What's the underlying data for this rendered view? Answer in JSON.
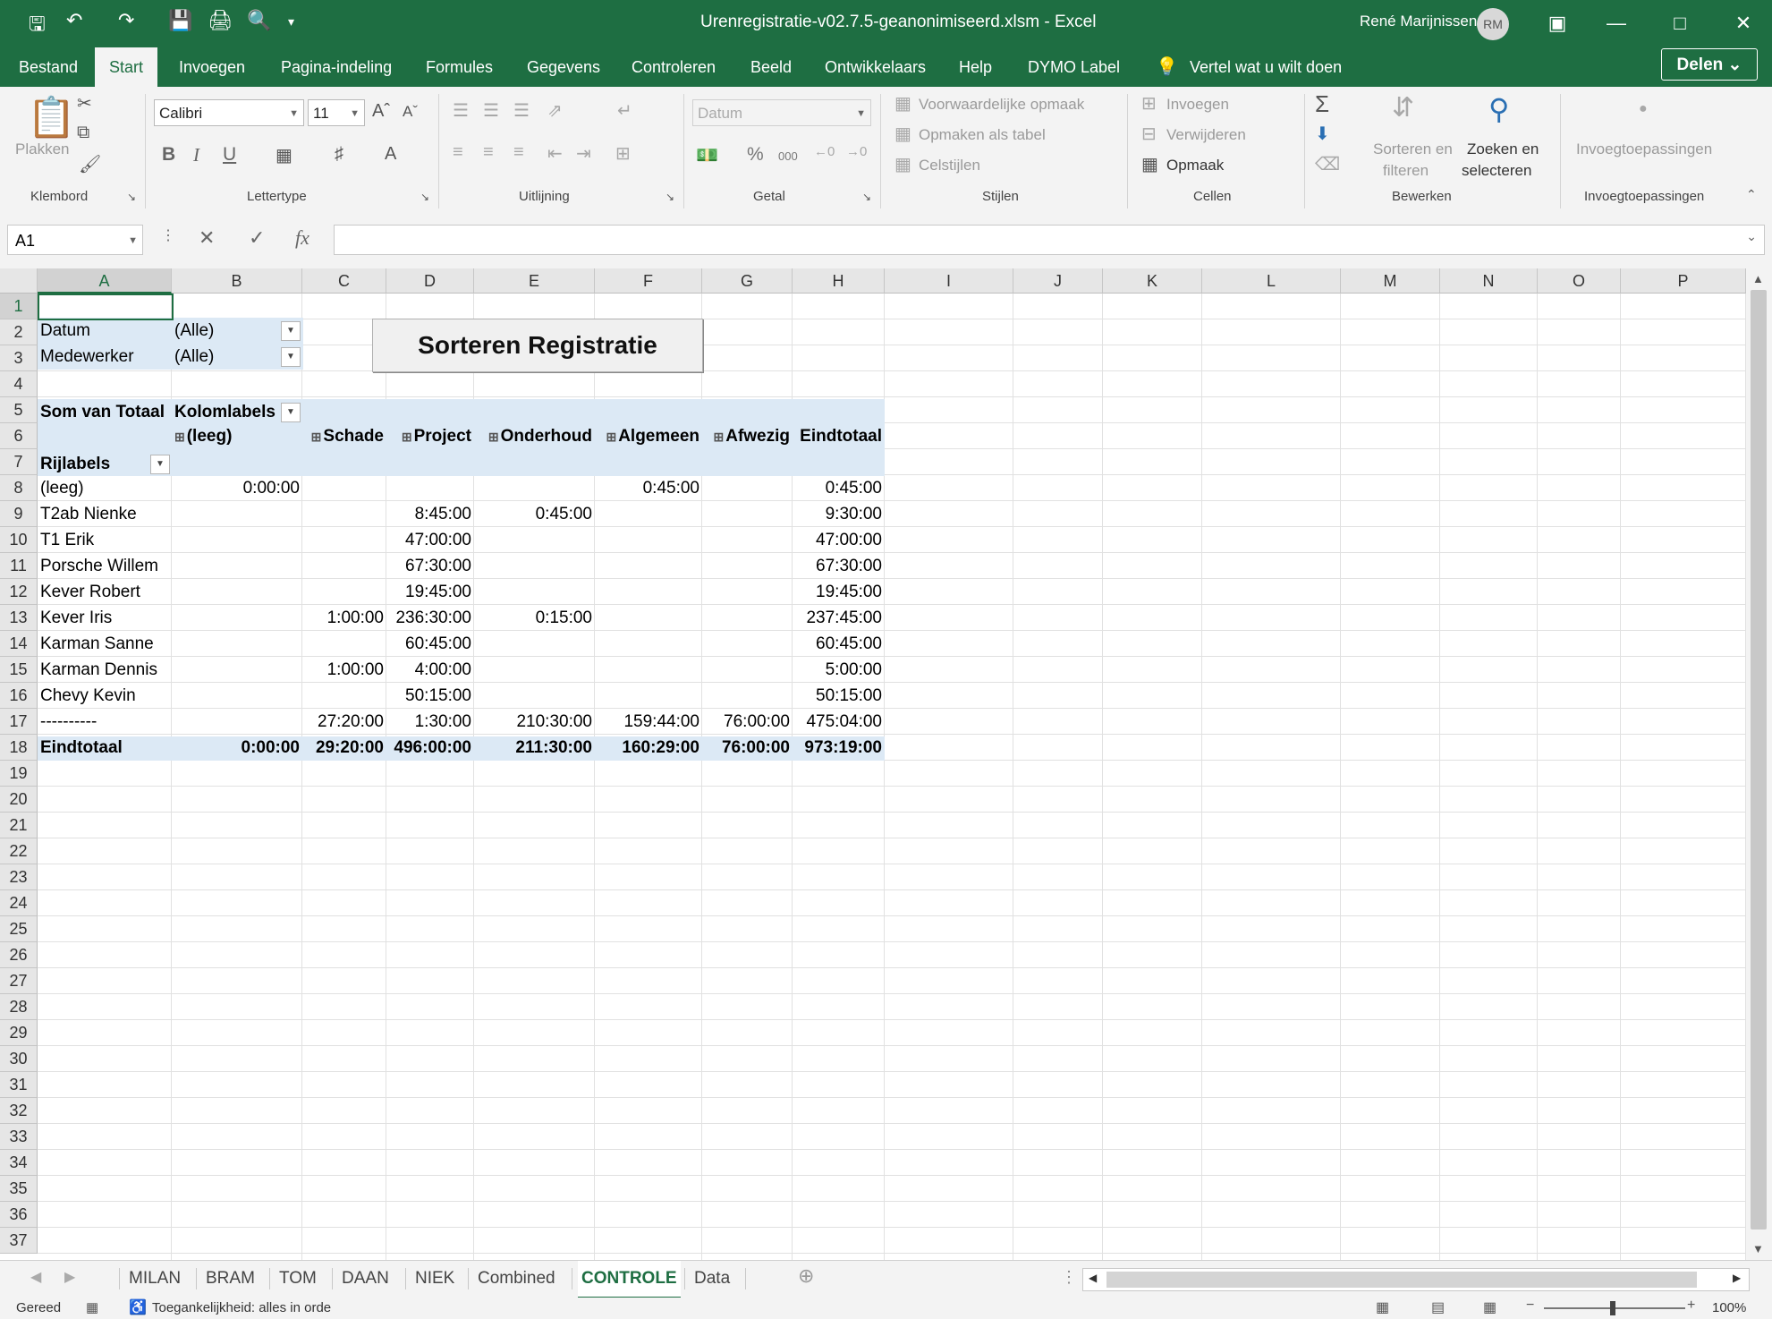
{
  "window": {
    "title": "Urenregistratie-v02.7.5-geanonimiseerd.xlsm  -  Excel",
    "user_name": "René Marijnissen",
    "user_initials": "RM"
  },
  "menu": {
    "tabs": [
      "Bestand",
      "Start",
      "Invoegen",
      "Pagina-indeling",
      "Formules",
      "Gegevens",
      "Controleren",
      "Beeld",
      "Ontwikkelaars",
      "Help",
      "DYMO Label"
    ],
    "tell_me": "Vertel wat u wilt doen",
    "share": "Delen"
  },
  "ribbon": {
    "clipboard": {
      "paste": "Plakken",
      "label": "Klembord"
    },
    "font": {
      "name": "Calibri",
      "size": "11",
      "label": "Lettertype",
      "bold": "B",
      "italic": "I",
      "underline": "U"
    },
    "alignment": {
      "label": "Uitlijning"
    },
    "number": {
      "format": "Datum",
      "percent": "%",
      "thousands": "000",
      "label": "Getal"
    },
    "styles": {
      "conditional": "Voorwaardelijke opmaak",
      "as_table": "Opmaken als tabel",
      "cell_styles": "Celstijlen",
      "label": "Stijlen"
    },
    "cells": {
      "insert": "Invoegen",
      "delete": "Verwijderen",
      "format": "Opmaak",
      "label": "Cellen"
    },
    "editing": {
      "sort_l1": "Sorteren en",
      "sort_l2": "filteren",
      "find_l1": "Zoeken en",
      "find_l2": "selecteren",
      "label": "Bewerken"
    },
    "addins": {
      "button": "Invoegtoepassingen",
      "label": "Invoegtoepassingen"
    }
  },
  "formula_bar": {
    "name_box": "A1",
    "fx": "fx",
    "value": ""
  },
  "columns": [
    "A",
    "B",
    "C",
    "D",
    "E",
    "F",
    "G",
    "H",
    "I",
    "J",
    "K",
    "L",
    "M",
    "N",
    "O",
    "P"
  ],
  "rows": [
    "1",
    "2",
    "3",
    "4",
    "5",
    "6",
    "7",
    "8",
    "9",
    "10",
    "11",
    "12",
    "13",
    "14",
    "15",
    "16",
    "17",
    "18",
    "19",
    "20",
    "21",
    "22",
    "23",
    "24",
    "25",
    "26",
    "27",
    "28",
    "29",
    "30",
    "31",
    "32",
    "33",
    "34",
    "35",
    "36",
    "37"
  ],
  "filters": {
    "date_label": "Datum",
    "date_value": "(Alle)",
    "employee_label": "Medewerker",
    "employee_value": "(Alle)"
  },
  "sort_button": "Sorteren Registratie",
  "pivot": {
    "values_label": "Som van Totaal",
    "column_labels": "Kolomlabels",
    "row_labels": "Rijlabels",
    "headers": [
      "(leeg)",
      "Schade",
      "Project",
      "Onderhoud",
      "Algemeen",
      "Afwezig",
      "Eindtotaal"
    ],
    "rows": [
      {
        "label": "(leeg)",
        "values": [
          "0:00:00",
          "",
          "",
          "",
          "0:45:00",
          "",
          "0:45:00"
        ]
      },
      {
        "label": "T2ab Nienke",
        "values": [
          "",
          "",
          "8:45:00",
          "0:45:00",
          "",
          "",
          "9:30:00"
        ]
      },
      {
        "label": "T1 Erik",
        "values": [
          "",
          "",
          "47:00:00",
          "",
          "",
          "",
          "47:00:00"
        ]
      },
      {
        "label": "Porsche Willem",
        "values": [
          "",
          "",
          "67:30:00",
          "",
          "",
          "",
          "67:30:00"
        ]
      },
      {
        "label": "Kever Robert",
        "values": [
          "",
          "",
          "19:45:00",
          "",
          "",
          "",
          "19:45:00"
        ]
      },
      {
        "label": "Kever Iris",
        "values": [
          "",
          "1:00:00",
          "236:30:00",
          "0:15:00",
          "",
          "",
          "237:45:00"
        ]
      },
      {
        "label": "Karman Sanne",
        "values": [
          "",
          "",
          "60:45:00",
          "",
          "",
          "",
          "60:45:00"
        ]
      },
      {
        "label": "Karman Dennis",
        "values": [
          "",
          "1:00:00",
          "4:00:00",
          "",
          "",
          "",
          "5:00:00"
        ]
      },
      {
        "label": "Chevy Kevin",
        "values": [
          "",
          "",
          "50:15:00",
          "",
          "",
          "",
          "50:15:00"
        ]
      },
      {
        "label": "----------",
        "values": [
          "",
          "27:20:00",
          "1:30:00",
          "210:30:00",
          "159:44:00",
          "76:00:00",
          "475:04:00"
        ]
      }
    ],
    "total": {
      "label": "Eindtotaal",
      "values": [
        "0:00:00",
        "29:20:00",
        "496:00:00",
        "211:30:00",
        "160:29:00",
        "76:00:00",
        "973:19:00"
      ]
    }
  },
  "sheets": [
    "MILAN",
    "BRAM",
    "TOM",
    "DAAN",
    "NIEK",
    "Combined",
    "CONTROLE",
    "Data"
  ],
  "active_sheet": "CONTROLE",
  "status": {
    "ready": "Gereed",
    "accessibility": "Toegankelijkheid: alles in orde",
    "zoom": "100%"
  },
  "colors": {
    "brand": "#1e6e42",
    "pivot_header": "#dce9f5"
  }
}
